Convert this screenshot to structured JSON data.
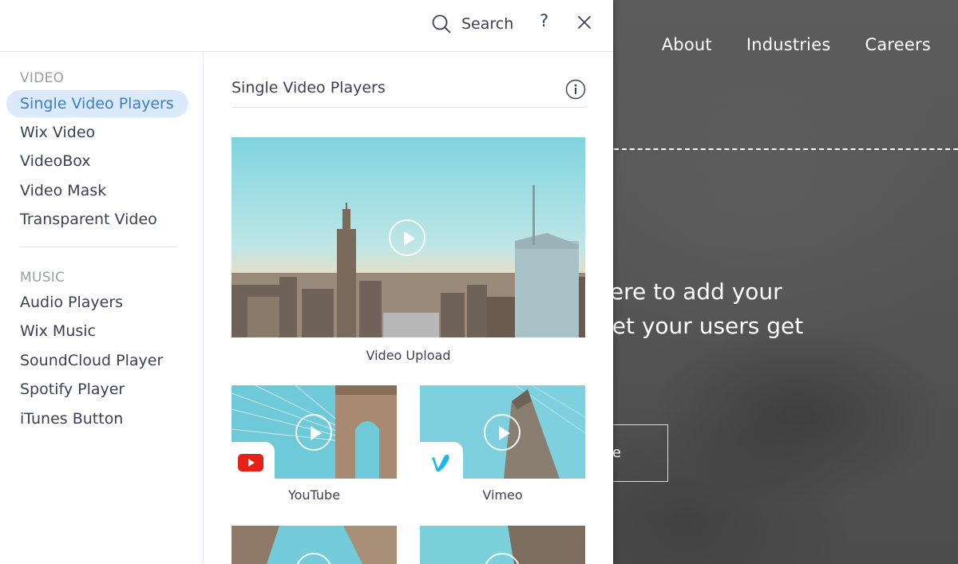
{
  "site": {
    "nav": [
      "About",
      "Industries",
      "Careers"
    ],
    "paragraph_lines": [
      "aph. Click here to add your",
      "d edit me. Let your users get",
      "."
    ],
    "button_fragment": "e"
  },
  "panel": {
    "search_label": "Search",
    "help_label": "?",
    "sections": [
      {
        "title": "VIDEO",
        "items": [
          "Single Video Players",
          "Wix Video",
          "VideoBox",
          "Video Mask",
          "Transparent Video"
        ]
      },
      {
        "title": "MUSIC",
        "items": [
          "Audio Players",
          "Wix Music",
          "SoundCloud Player",
          "Spotify Player",
          "iTunes Button"
        ]
      }
    ],
    "active_item": "Single Video Players",
    "content_title": "Single Video Players",
    "cards": [
      "Video Upload",
      "YouTube",
      "Vimeo"
    ]
  },
  "colors": {
    "accent": "#3b7fc4",
    "active_bg": "#dbeafb",
    "youtube_red": "#e62117",
    "vimeo_blue": "#1ab7ea"
  }
}
